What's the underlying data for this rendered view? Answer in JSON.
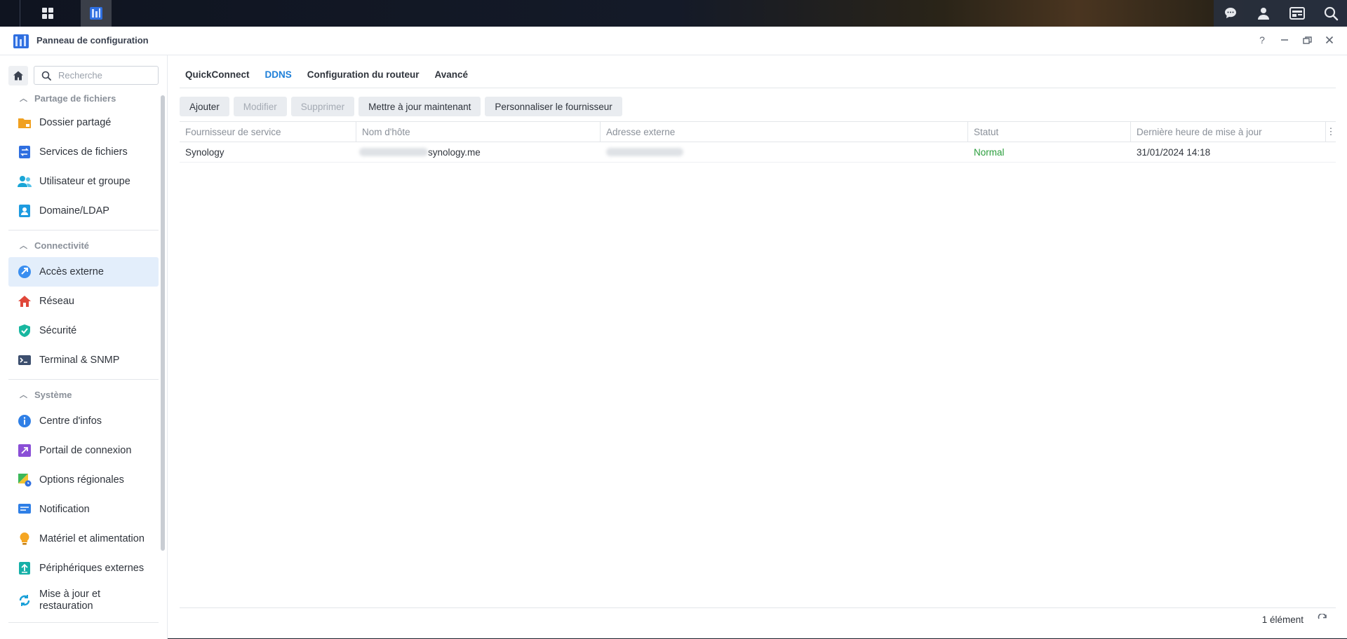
{
  "window": {
    "title": "Panneau de configuration"
  },
  "search": {
    "placeholder": "Recherche"
  },
  "sidebar": {
    "sections": [
      {
        "title": "Partage de fichiers",
        "items": [
          "Dossier partagé",
          "Services de fichiers",
          "Utilisateur et groupe",
          "Domaine/LDAP"
        ]
      },
      {
        "title": "Connectivité",
        "items": [
          "Accès externe",
          "Réseau",
          "Sécurité",
          "Terminal & SNMP"
        ]
      },
      {
        "title": "Système",
        "items": [
          "Centre d'infos",
          "Portail de connexion",
          "Options régionales",
          "Notification",
          "Matériel et alimentation",
          "Périphériques externes",
          "Mise à jour et restauration"
        ]
      }
    ],
    "selected": "Accès externe"
  },
  "tabs": [
    "QuickConnect",
    "DDNS",
    "Configuration du routeur",
    "Avancé"
  ],
  "active_tab": "DDNS",
  "toolbar": {
    "add": "Ajouter",
    "modify": "Modifier",
    "delete": "Supprimer",
    "update_now": "Mettre à jour maintenant",
    "customize_provider": "Personnaliser le fournisseur"
  },
  "table": {
    "columns": [
      "Fournisseur de service",
      "Nom d'hôte",
      "Adresse externe",
      "Statut",
      "Dernière heure de mise à jour"
    ],
    "rows": [
      {
        "provider": "Synology",
        "hostname": "synology.me",
        "external_address": "",
        "status": "Normal",
        "last_update": "31/01/2024 14:18"
      }
    ]
  },
  "footer": {
    "count": "1 élément"
  },
  "colors": {
    "accent": "#1e7fd8",
    "status_ok": "#2a9d3c",
    "selected_bg": "#e3eefb"
  }
}
